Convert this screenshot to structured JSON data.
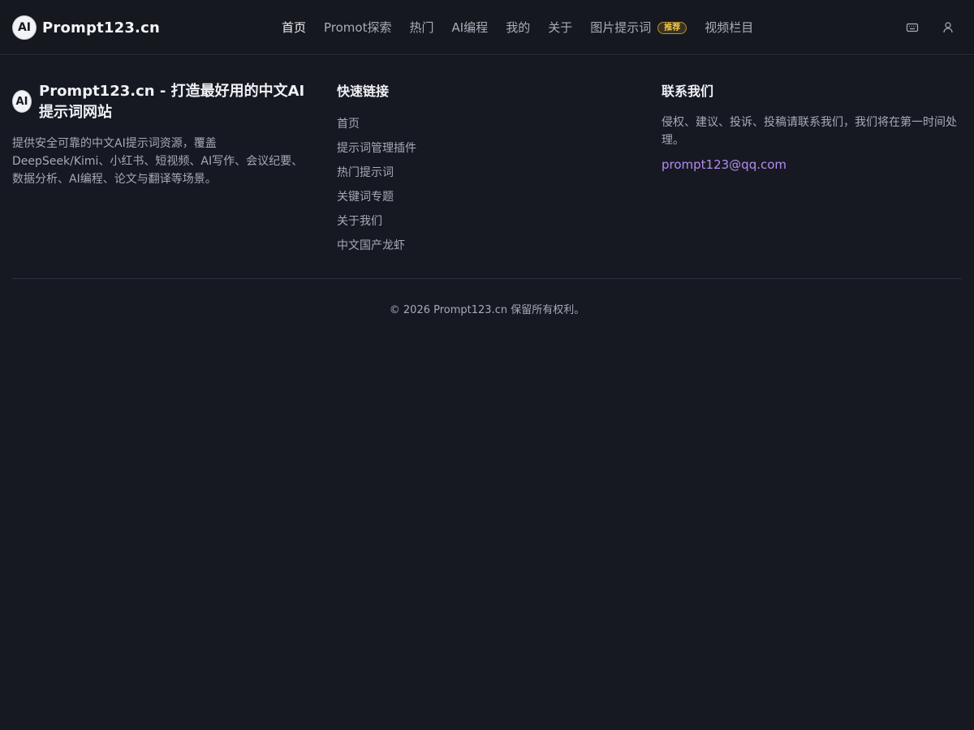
{
  "brand": {
    "logo_text": "AI",
    "name": "Prompt123.cn"
  },
  "nav": {
    "items": [
      {
        "label": "首页",
        "active": true
      },
      {
        "label": "Promot探索"
      },
      {
        "label": "热门"
      },
      {
        "label": "AI编程"
      },
      {
        "label": "我的"
      },
      {
        "label": "关于"
      },
      {
        "label": "图片提示词",
        "badge": "推荐"
      },
      {
        "label": "视频栏目"
      }
    ],
    "right_icons": [
      "keyboard-icon",
      "user-icon"
    ]
  },
  "footer": {
    "about": {
      "logo_text": "AI",
      "title": "Prompt123.cn - 打造最好用的中文AI提示词网站",
      "description": "提供安全可靠的中文AI提示词资源，覆盖DeepSeek/Kimi、小红书、短视频、AI写作、会议纪要、数据分析、AI编程、论文与翻译等场景。"
    },
    "links": {
      "title": "快速链接",
      "items": [
        "首页",
        "提示词管理插件",
        "热门提示词",
        "关键词专题",
        "关于我们",
        "中文国产龙虾"
      ]
    },
    "contact": {
      "title": "联系我们",
      "description": "侵权、建议、投诉、投稿请联系我们，我们将在第一时间处理。",
      "email": "prompt123@qq.com"
    },
    "copyright": "© 2026 Prompt123.cn 保留所有权利。"
  },
  "colors": {
    "background": "#171922",
    "accent_link": "#b48cf0",
    "badge": "#f2c94c"
  }
}
